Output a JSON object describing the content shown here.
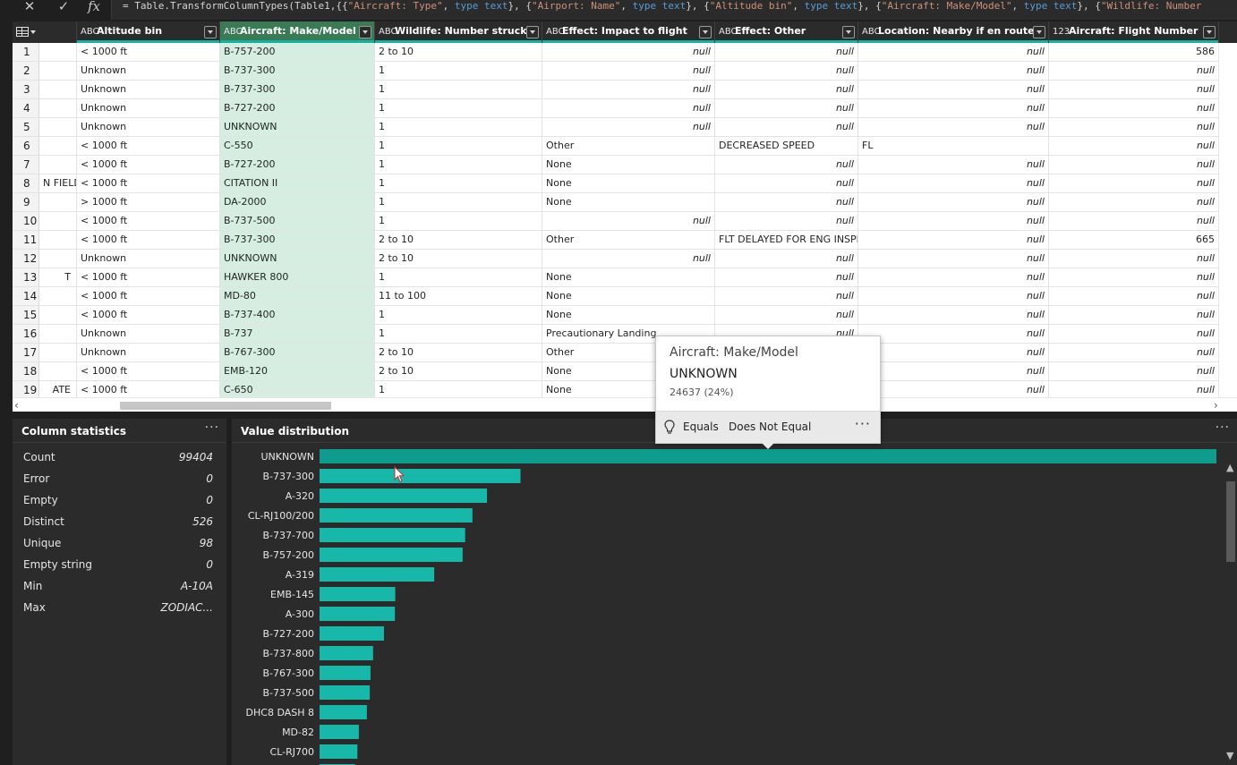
{
  "formula_bar": {
    "cancel_icon": "close-icon",
    "commit_icon": "check-icon",
    "fx_label": "fx",
    "segments": [
      {
        "t": "= Table.TransformColumnTypes(Table1,{{",
        "c": ""
      },
      {
        "t": "\"Aircraft: Type\"",
        "c": "str"
      },
      {
        "t": ", ",
        "c": ""
      },
      {
        "t": "type text",
        "c": "kw"
      },
      {
        "t": "}, {",
        "c": ""
      },
      {
        "t": "\"Airport: Name\"",
        "c": "str"
      },
      {
        "t": ", ",
        "c": ""
      },
      {
        "t": "type text",
        "c": "kw"
      },
      {
        "t": "}, {",
        "c": ""
      },
      {
        "t": "\"Altitude bin\"",
        "c": "str"
      },
      {
        "t": ", ",
        "c": ""
      },
      {
        "t": "type text",
        "c": "kw"
      },
      {
        "t": "}, {",
        "c": ""
      },
      {
        "t": "\"Aircraft: Make/Model\"",
        "c": "str"
      },
      {
        "t": ", ",
        "c": ""
      },
      {
        "t": "type text",
        "c": "kw"
      },
      {
        "t": "}, {",
        "c": ""
      },
      {
        "t": "\"Wildlife: Number",
        "c": "str"
      }
    ]
  },
  "grid": {
    "columns": [
      {
        "key": "partial",
        "type": "",
        "label": "",
        "w": 72
      },
      {
        "key": "alt",
        "type": "ABC",
        "label": "Altitude bin",
        "w": 160
      },
      {
        "key": "model",
        "type": "ABC",
        "label": "Aircraft: Make/Model",
        "w": 173,
        "selected": true
      },
      {
        "key": "wild",
        "type": "ABC",
        "label": "Wildlife: Number struck",
        "w": 187
      },
      {
        "key": "impact",
        "type": "ABC",
        "label": "Effect: Impact to flight",
        "w": 193
      },
      {
        "key": "other",
        "type": "ABC",
        "label": "Effect: Other",
        "w": 160
      },
      {
        "key": "loc",
        "type": "ABC",
        "label": "Location: Nearby if en route",
        "w": 213
      },
      {
        "key": "flight",
        "type": "123",
        "label": "Aircraft: Flight Number",
        "w": 190
      }
    ],
    "rows": [
      {
        "n": "1",
        "partial": "",
        "alt": "< 1000 ft",
        "model": "B-757-200",
        "wild": "2 to 10",
        "impact": "null",
        "other": "null",
        "loc": "null",
        "flight": "586"
      },
      {
        "n": "2",
        "partial": "",
        "alt": "Unknown",
        "model": "B-737-300",
        "wild": "1",
        "impact": "null",
        "other": "null",
        "loc": "null",
        "flight": "null"
      },
      {
        "n": "3",
        "partial": "",
        "alt": "Unknown",
        "model": "B-737-300",
        "wild": "1",
        "impact": "null",
        "other": "null",
        "loc": "null",
        "flight": "null"
      },
      {
        "n": "4",
        "partial": "",
        "alt": "Unknown",
        "model": "B-727-200",
        "wild": "1",
        "impact": "null",
        "other": "null",
        "loc": "null",
        "flight": "null"
      },
      {
        "n": "5",
        "partial": "",
        "alt": "Unknown",
        "model": "UNKNOWN",
        "wild": "1",
        "impact": "null",
        "other": "null",
        "loc": "null",
        "flight": "null"
      },
      {
        "n": "6",
        "partial": "",
        "alt": "< 1000 ft",
        "model": "C-550",
        "wild": "1",
        "impact": "Other",
        "other": "DECREASED SPEED",
        "loc": "FL",
        "flight": "null"
      },
      {
        "n": "7",
        "partial": "",
        "alt": "< 1000 ft",
        "model": "B-727-200",
        "wild": "1",
        "impact": "None",
        "other": "null",
        "loc": "null",
        "flight": "null"
      },
      {
        "n": "8",
        "partial": "N FIELD",
        "alt": "< 1000 ft",
        "model": "CITATION II",
        "wild": "1",
        "impact": "None",
        "other": "null",
        "loc": "null",
        "flight": "null"
      },
      {
        "n": "9",
        "partial": "",
        "alt": "> 1000 ft",
        "model": "DA-2000",
        "wild": "1",
        "impact": "None",
        "other": "null",
        "loc": "null",
        "flight": "null"
      },
      {
        "n": "10",
        "partial": "",
        "alt": "< 1000 ft",
        "model": "B-737-500",
        "wild": "1",
        "impact": "null",
        "other": "null",
        "loc": "null",
        "flight": "null"
      },
      {
        "n": "11",
        "partial": "",
        "alt": "< 1000 ft",
        "model": "B-737-300",
        "wild": "2 to 10",
        "impact": "Other",
        "other": "FLT DELAYED FOR ENG INSPN",
        "loc": "null",
        "flight": "665"
      },
      {
        "n": "12",
        "partial": "",
        "alt": "Unknown",
        "model": "UNKNOWN",
        "wild": "2 to 10",
        "impact": "null",
        "other": "null",
        "loc": "null",
        "flight": "null"
      },
      {
        "n": "13",
        "partial": "T",
        "alt": "< 1000 ft",
        "model": "HAWKER 800",
        "wild": "1",
        "impact": "None",
        "other": "null",
        "loc": "null",
        "flight": "null"
      },
      {
        "n": "14",
        "partial": "",
        "alt": "< 1000 ft",
        "model": "MD-80",
        "wild": "11 to 100",
        "impact": "None",
        "other": "null",
        "loc": "null",
        "flight": "null"
      },
      {
        "n": "15",
        "partial": "",
        "alt": "< 1000 ft",
        "model": "B-737-400",
        "wild": "1",
        "impact": "None",
        "other": "null",
        "loc": "null",
        "flight": "null"
      },
      {
        "n": "16",
        "partial": "",
        "alt": "Unknown",
        "model": "B-737",
        "wild": "1",
        "impact": "Precautionary Landing",
        "other": "null",
        "loc": "null",
        "flight": "null"
      },
      {
        "n": "17",
        "partial": "",
        "alt": "Unknown",
        "model": "B-767-300",
        "wild": "2 to 10",
        "impact": "Other",
        "other": "null",
        "loc": "null",
        "flight": "null"
      },
      {
        "n": "18",
        "partial": "",
        "alt": "< 1000 ft",
        "model": "EMB-120",
        "wild": "2 to 10",
        "impact": "None",
        "other": "null",
        "loc": "null",
        "flight": "null"
      },
      {
        "n": "19",
        "partial": "ATE",
        "alt": "< 1000 ft",
        "model": "C-650",
        "wild": "1",
        "impact": "None",
        "other": "null",
        "loc": "null",
        "flight": "null"
      }
    ]
  },
  "stats": {
    "title": "Column statistics",
    "more": "···",
    "items": [
      {
        "label": "Count",
        "value": "99404"
      },
      {
        "label": "Error",
        "value": "0"
      },
      {
        "label": "Empty",
        "value": "0"
      },
      {
        "label": "Distinct",
        "value": "526"
      },
      {
        "label": "Unique",
        "value": "98"
      },
      {
        "label": "Empty string",
        "value": "0"
      },
      {
        "label": "Min",
        "value": "A-10A"
      },
      {
        "label": "Max",
        "value": "ZODIAC..."
      }
    ]
  },
  "distribution": {
    "title": "Value distribution",
    "more": "···"
  },
  "chart_data": {
    "type": "bar",
    "orientation": "horizontal",
    "categories": [
      "UNKNOWN",
      "B-737-300",
      "A-320",
      "CL-RJ100/200",
      "B-737-700",
      "B-757-200",
      "A-319",
      "EMB-145",
      "A-300",
      "B-727-200",
      "B-737-800",
      "B-767-300",
      "B-737-500",
      "DHC8 DASH 8",
      "MD-82",
      "CL-RJ700"
    ],
    "values": [
      24637,
      5520,
      4600,
      4200,
      4000,
      3930,
      3150,
      2080,
      2070,
      1770,
      1470,
      1400,
      1380,
      1300,
      1080,
      1040
    ],
    "xlim": [
      0,
      24637
    ],
    "colors": {
      "highlight": "#0e9c8f",
      "bar": "#17b8aa"
    }
  },
  "tooltip": {
    "title": "Aircraft: Make/Model",
    "value": "UNKNOWN",
    "count": "24637 (24%)",
    "equals": "Equals",
    "not_equal": "Does Not Equal",
    "more": "···"
  }
}
